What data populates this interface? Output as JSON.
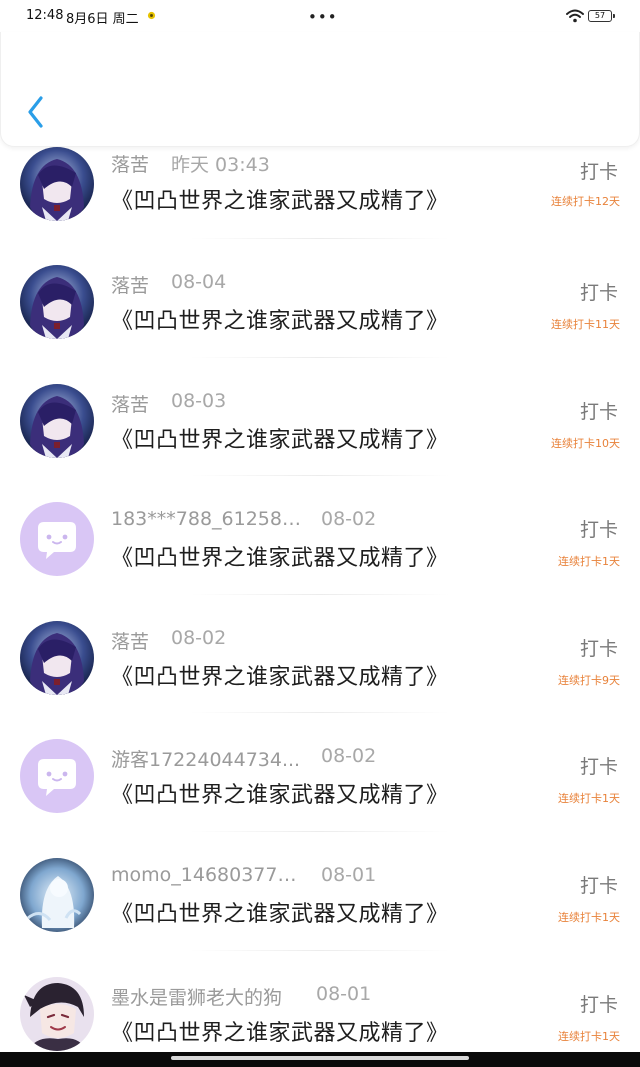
{
  "status_bar": {
    "time": "12:48",
    "date": "8月6日 周二",
    "center_dots": "•••",
    "battery": "57"
  },
  "header": {
    "back_icon": "chevron-left-icon",
    "accent_color": "#2a9ee8"
  },
  "items": [
    {
      "name": "落苦",
      "date": "昨天 03:43",
      "title": "《凹凸世界之谁家武器又成精了》",
      "checkin": "打卡",
      "streak": "连续打卡12天",
      "avatar": "anime-purple"
    },
    {
      "name": "落苦",
      "date": "08-04",
      "title": "《凹凸世界之谁家武器又成精了》",
      "checkin": "打卡",
      "streak": "连续打卡11天",
      "avatar": "anime-purple"
    },
    {
      "name": "落苦",
      "date": "08-03",
      "title": "《凹凸世界之谁家武器又成精了》",
      "checkin": "打卡",
      "streak": "连续打卡10天",
      "avatar": "anime-purple"
    },
    {
      "name": "183***788_612580...",
      "date": "08-02",
      "title": "《凹凸世界之谁家武器又成精了》",
      "checkin": "打卡",
      "streak": "连续打卡1天",
      "avatar": "default-bubble"
    },
    {
      "name": "落苦",
      "date": "08-02",
      "title": "《凹凸世界之谁家武器又成精了》",
      "checkin": "打卡",
      "streak": "连续打卡9天",
      "avatar": "anime-purple"
    },
    {
      "name": "游客17224044734...",
      "date": "08-02",
      "title": "《凹凸世界之谁家武器又成精了》",
      "checkin": "打卡",
      "streak": "连续打卡1天",
      "avatar": "default-bubble"
    },
    {
      "name": "momo_146803772...",
      "date": "08-01",
      "title": "《凹凸世界之谁家武器又成精了》",
      "checkin": "打卡",
      "streak": "连续打卡1天",
      "avatar": "anime-white"
    },
    {
      "name": "墨水是雷狮老大的狗",
      "date": "08-01",
      "title": "《凹凸世界之谁家武器又成精了》",
      "checkin": "打卡",
      "streak": "连续打卡1天",
      "avatar": "anime-dark"
    }
  ],
  "colors": {
    "streak": "#e8823a",
    "checkin": "#7a7a7a",
    "name": "#9a9a9a",
    "default_avatar_bg": "#d9c6f5"
  }
}
